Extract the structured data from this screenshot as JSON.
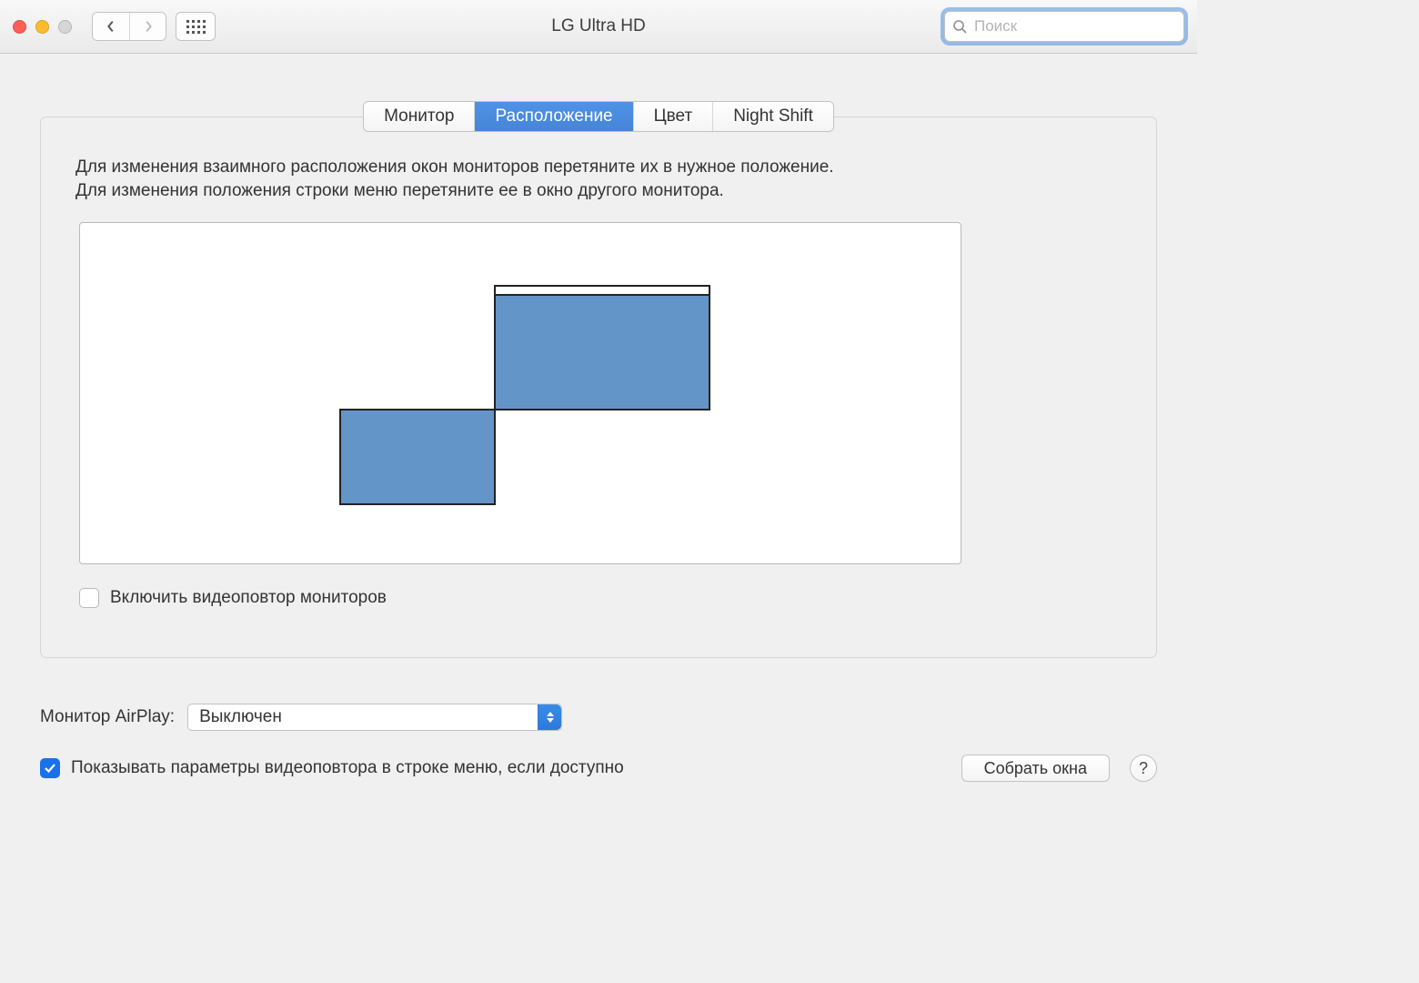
{
  "window": {
    "title": "LG Ultra HD"
  },
  "search": {
    "placeholder": "Поиск",
    "value": ""
  },
  "tabs": {
    "monitor": "Монитор",
    "arrangement": "Расположение",
    "color": "Цвет",
    "nightshift": "Night Shift"
  },
  "panel": {
    "instructions_line1": "Для изменения взаимного расположения окон мониторов перетяните их в нужное положение.",
    "instructions_line2": "Для изменения положения строки меню перетяните ее в окно другого монитора.",
    "mirror_label": "Включить видеоповтор мониторов"
  },
  "airplay": {
    "label": "Монитор AirPlay:",
    "value": "Выключен"
  },
  "footer": {
    "show_mirror_label": "Показывать параметры видеоповтора в строке меню, если доступно",
    "gather_button": "Собрать окна",
    "help": "?"
  }
}
